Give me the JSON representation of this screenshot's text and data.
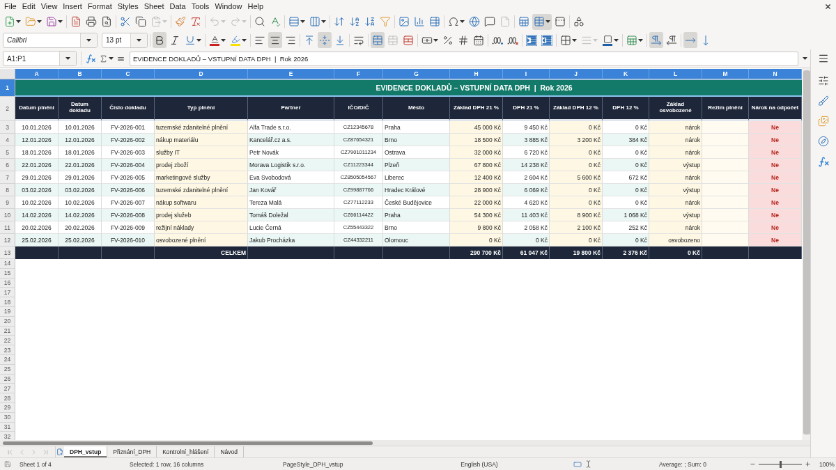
{
  "menu": [
    "File",
    "Edit",
    "View",
    "Insert",
    "Format",
    "Styles",
    "Sheet",
    "Data",
    "Tools",
    "Window",
    "Help"
  ],
  "standard_toolbar": {
    "groups": [
      {
        "buttons": [
          {
            "kind": "new",
            "dropdown": true,
            "pressed": false,
            "disabled": false
          },
          {
            "kind": "open",
            "dropdown": true,
            "pressed": false,
            "disabled": false
          },
          {
            "kind": "save",
            "dropdown": true,
            "pressed": false,
            "disabled": false
          }
        ]
      },
      {
        "buttons": [
          {
            "kind": "export_pdf",
            "dropdown": false,
            "pressed": false,
            "disabled": false
          },
          {
            "kind": "print",
            "dropdown": false,
            "pressed": false,
            "disabled": false
          },
          {
            "kind": "print_preview",
            "dropdown": false,
            "pressed": false,
            "disabled": false
          }
        ]
      },
      {
        "buttons": [
          {
            "kind": "cut",
            "dropdown": false,
            "pressed": false,
            "disabled": false
          },
          {
            "kind": "copy",
            "dropdown": false,
            "pressed": false,
            "disabled": false
          },
          {
            "kind": "paste",
            "dropdown": true,
            "pressed": false,
            "disabled": true
          }
        ]
      },
      {
        "buttons": [
          {
            "kind": "clone_formatting",
            "dropdown": false,
            "pressed": false,
            "disabled": false
          },
          {
            "kind": "clear_formatting",
            "dropdown": false,
            "pressed": false,
            "disabled": false
          }
        ]
      },
      {
        "buttons": [
          {
            "kind": "undo",
            "dropdown": true,
            "pressed": false,
            "disabled": true
          },
          {
            "kind": "redo",
            "dropdown": true,
            "pressed": false,
            "disabled": true
          }
        ]
      },
      {
        "buttons": [
          {
            "kind": "find_replace",
            "dropdown": false,
            "pressed": false,
            "disabled": false
          },
          {
            "kind": "spelling",
            "dropdown": false,
            "pressed": false,
            "disabled": false
          }
        ]
      },
      {
        "buttons": [
          {
            "kind": "row",
            "dropdown": true,
            "pressed": false,
            "disabled": false
          },
          {
            "kind": "column",
            "dropdown": true,
            "pressed": false,
            "disabled": false
          }
        ]
      },
      {
        "buttons": [
          {
            "kind": "sort",
            "dropdown": false,
            "pressed": false,
            "disabled": false
          },
          {
            "kind": "sort_ascending",
            "dropdown": false,
            "pressed": false,
            "disabled": false
          },
          {
            "kind": "sort_descending",
            "dropdown": false,
            "pressed": false,
            "disabled": false
          },
          {
            "kind": "autofilter",
            "dropdown": false,
            "pressed": false,
            "disabled": false
          }
        ]
      },
      {
        "buttons": [
          {
            "kind": "image",
            "dropdown": false,
            "pressed": false,
            "disabled": false
          },
          {
            "kind": "chart",
            "dropdown": false,
            "pressed": false,
            "disabled": false
          },
          {
            "kind": "pivot_table",
            "dropdown": false,
            "pressed": false,
            "disabled": false
          }
        ]
      },
      {
        "buttons": [
          {
            "kind": "special_character",
            "dropdown": true,
            "pressed": false,
            "disabled": false
          },
          {
            "kind": "hyperlink",
            "dropdown": false,
            "pressed": false,
            "disabled": false
          },
          {
            "kind": "comment",
            "dropdown": false,
            "pressed": false,
            "disabled": false
          },
          {
            "kind": "header_footer",
            "dropdown": false,
            "pressed": false,
            "disabled": true
          }
        ]
      },
      {
        "buttons": [
          {
            "kind": "print_area",
            "dropdown": false,
            "pressed": false,
            "disabled": false
          },
          {
            "kind": "freeze",
            "dropdown": true,
            "pressed": true,
            "disabled": false
          },
          {
            "kind": "split_window",
            "dropdown": false,
            "pressed": false,
            "disabled": false
          }
        ]
      },
      {
        "buttons": [
          {
            "kind": "draw_functions",
            "dropdown": false,
            "pressed": false,
            "disabled": false
          }
        ]
      }
    ]
  },
  "formatting_toolbar": {
    "font_name": "Calibri",
    "font_size": "13 pt",
    "groups": [
      {
        "buttons": [
          {
            "kind": "bold",
            "dropdown": false,
            "pressed": true,
            "disabled": false
          },
          {
            "kind": "italic",
            "dropdown": false,
            "pressed": false,
            "disabled": false
          },
          {
            "kind": "underline",
            "dropdown": true,
            "pressed": false,
            "disabled": false
          }
        ]
      },
      {
        "buttons": [
          {
            "kind": "font_color",
            "dropdown": true,
            "pressed": false,
            "disabled": false
          },
          {
            "kind": "highlight",
            "dropdown": true,
            "pressed": false,
            "disabled": false
          }
        ]
      },
      {
        "buttons": [
          {
            "kind": "align_left",
            "dropdown": false,
            "pressed": false,
            "disabled": false
          },
          {
            "kind": "align_center",
            "dropdown": false,
            "pressed": true,
            "disabled": false
          },
          {
            "kind": "align_right",
            "dropdown": false,
            "pressed": false,
            "disabled": false
          }
        ]
      },
      {
        "buttons": [
          {
            "kind": "align_top",
            "dropdown": false,
            "pressed": false,
            "disabled": false
          },
          {
            "kind": "center_vertically",
            "dropdown": false,
            "pressed": true,
            "disabled": false
          },
          {
            "kind": "align_bottom",
            "dropdown": false,
            "pressed": false,
            "disabled": false
          }
        ]
      },
      {
        "buttons": [
          {
            "kind": "wrap_text",
            "dropdown": false,
            "pressed": false,
            "disabled": false
          }
        ]
      },
      {
        "buttons": [
          {
            "kind": "merge_center",
            "dropdown": false,
            "pressed": true,
            "disabled": false
          },
          {
            "kind": "merge_cells",
            "dropdown": false,
            "pressed": false,
            "disabled": true
          },
          {
            "kind": "unmerge",
            "dropdown": false,
            "pressed": false,
            "disabled": false
          }
        ]
      },
      {
        "buttons": [
          {
            "kind": "currency",
            "dropdown": true,
            "pressed": false,
            "disabled": false
          },
          {
            "kind": "percent",
            "dropdown": false,
            "pressed": false,
            "disabled": false
          },
          {
            "kind": "number",
            "dropdown": false,
            "pressed": false,
            "disabled": false
          },
          {
            "kind": "date",
            "dropdown": false,
            "pressed": false,
            "disabled": false
          }
        ]
      },
      {
        "buttons": [
          {
            "kind": "add_decimal",
            "dropdown": false,
            "pressed": false,
            "disabled": false
          },
          {
            "kind": "delete_decimal",
            "dropdown": false,
            "pressed": false,
            "disabled": false
          }
        ]
      },
      {
        "buttons": [
          {
            "kind": "indent_increase",
            "dropdown": false,
            "pressed": false,
            "disabled": false
          },
          {
            "kind": "indent_decrease",
            "dropdown": false,
            "pressed": false,
            "disabled": false
          }
        ]
      },
      {
        "buttons": [
          {
            "kind": "borders",
            "dropdown": true,
            "pressed": false,
            "disabled": false
          },
          {
            "kind": "border_style",
            "dropdown": true,
            "pressed": false,
            "disabled": true
          },
          {
            "kind": "border_color",
            "dropdown": true,
            "pressed": false,
            "disabled": false
          }
        ]
      },
      {
        "buttons": [
          {
            "kind": "conditional",
            "dropdown": true,
            "pressed": false,
            "disabled": false
          }
        ]
      },
      {
        "buttons": [
          {
            "kind": "left_to_right",
            "dropdown": false,
            "pressed": true,
            "disabled": false
          },
          {
            "kind": "right_to_left",
            "dropdown": false,
            "pressed": false,
            "disabled": false
          }
        ]
      },
      {
        "buttons": [
          {
            "kind": "text_horizontal",
            "dropdown": false,
            "pressed": true,
            "disabled": false
          },
          {
            "kind": "text_vertical",
            "dropdown": false,
            "pressed": false,
            "disabled": false
          }
        ]
      }
    ]
  },
  "formula_bar": {
    "cell_reference": "A1:P1",
    "content": "EVIDENCE DOKLADŮ – VSTUPNÍ DATA DPH  |  Rok 2026"
  },
  "sheet": {
    "columns": [
      {
        "label": "A",
        "selected": true
      },
      {
        "label": "B",
        "selected": true
      },
      {
        "label": "C",
        "selected": true
      },
      {
        "label": "D",
        "selected": true
      },
      {
        "label": "E",
        "selected": true
      },
      {
        "label": "F",
        "selected": true
      },
      {
        "label": "G",
        "selected": true
      },
      {
        "label": "H",
        "selected": true
      },
      {
        "label": "I",
        "selected": true
      },
      {
        "label": "J",
        "selected": true
      },
      {
        "label": "K",
        "selected": true
      },
      {
        "label": "L",
        "selected": true
      },
      {
        "label": "M",
        "selected": true
      },
      {
        "label": "N",
        "selected": true
      }
    ],
    "row_numbers": [
      {
        "label": "1",
        "selected": true
      },
      {
        "label": "2",
        "selected": false
      },
      {
        "label": "3",
        "selected": false
      },
      {
        "label": "4",
        "selected": false
      },
      {
        "label": "5",
        "selected": false
      },
      {
        "label": "6",
        "selected": false
      },
      {
        "label": "7",
        "selected": false
      },
      {
        "label": "8",
        "selected": false
      },
      {
        "label": "9",
        "selected": false
      },
      {
        "label": "10",
        "selected": false
      },
      {
        "label": "11",
        "selected": false
      },
      {
        "label": "12",
        "selected": false
      },
      {
        "label": "13",
        "selected": false
      },
      {
        "label": "14",
        "selected": false
      },
      {
        "label": "15",
        "selected": false
      },
      {
        "label": "16",
        "selected": false
      },
      {
        "label": "17",
        "selected": false
      },
      {
        "label": "18",
        "selected": false
      },
      {
        "label": "19",
        "selected": false
      },
      {
        "label": "20",
        "selected": false
      },
      {
        "label": "21",
        "selected": false
      },
      {
        "label": "22",
        "selected": false
      },
      {
        "label": "23",
        "selected": false
      },
      {
        "label": "24",
        "selected": false
      },
      {
        "label": "25",
        "selected": false
      },
      {
        "label": "26",
        "selected": false
      },
      {
        "label": "27",
        "selected": false
      },
      {
        "label": "28",
        "selected": false
      },
      {
        "label": "29",
        "selected": false
      },
      {
        "label": "30",
        "selected": false
      },
      {
        "label": "31",
        "selected": false
      },
      {
        "label": "32",
        "selected": false
      }
    ],
    "title": "EVIDENCE DOKLADŮ – VSTUPNÍ DATA DPH  |  Rok 2026",
    "headers": [
      "Datum plnění",
      "Datum dokladu",
      "Číslo dokladu",
      "Typ plnění",
      "Partner",
      "IČO/DIČ",
      "Město",
      "Základ DPH 21 %",
      "DPH 21 %",
      "Základ DPH 12 %",
      "DPH 12 %",
      "Základ osvobozené",
      "Režim plnění",
      "Nárok na odpočet"
    ],
    "rows": [
      {
        "date_of_supply": "10.01.2026",
        "document_date": "10.01.2026",
        "document_number": "FV-2026-001",
        "supply_type": "tuzemské zdanitelné plnění",
        "partner": "Alfa Trade s.r.o.",
        "ico_dic": "CZ12345678",
        "city": "Praha",
        "base_21": "45 000 Kč",
        "vat_21": "9 450 Kč",
        "base_12": "0 Kč",
        "vat_12": "0 Kč",
        "exempt_base": "nárok",
        "deduction_claim": "Ne"
      },
      {
        "date_of_supply": "12.01.2026",
        "document_date": "12.01.2026",
        "document_number": "FV-2026-002",
        "supply_type": "nákup materiálu",
        "partner": "Kancelář.cz a.s.",
        "ico_dic": "CZ87654321",
        "city": "Brno",
        "base_21": "18 500 Kč",
        "vat_21": "3 885 Kč",
        "base_12": "3 200 Kč",
        "vat_12": "384 Kč",
        "exempt_base": "nárok",
        "deduction_claim": "Ne"
      },
      {
        "date_of_supply": "18.01.2026",
        "document_date": "18.01.2026",
        "document_number": "FV-2026-003",
        "supply_type": "služby IT",
        "partner": "Petr Novák",
        "ico_dic": "CZ7901011234",
        "city": "Ostrava",
        "base_21": "32 000 Kč",
        "vat_21": "6 720 Kč",
        "base_12": "0 Kč",
        "vat_12": "0 Kč",
        "exempt_base": "nárok",
        "deduction_claim": "Ne"
      },
      {
        "date_of_supply": "22.01.2026",
        "document_date": "22.01.2026",
        "document_number": "FV-2026-004",
        "supply_type": "prodej zboží",
        "partner": "Morava Logistik s.r.o.",
        "ico_dic": "CZ11223344",
        "city": "Plzeň",
        "base_21": "67 800 Kč",
        "vat_21": "14 238 Kč",
        "base_12": "0 Kč",
        "vat_12": "0 Kč",
        "exempt_base": "výstup",
        "deduction_claim": "Ne"
      },
      {
        "date_of_supply": "29.01.2026",
        "document_date": "29.01.2026",
        "document_number": "FV-2026-005",
        "supply_type": "marketingové služby",
        "partner": "Eva Svobodová",
        "ico_dic": "CZ8505054567",
        "city": "Liberec",
        "base_21": "12 400 Kč",
        "vat_21": "2 604 Kč",
        "base_12": "5 600 Kč",
        "vat_12": "672 Kč",
        "exempt_base": "nárok",
        "deduction_claim": "Ne"
      },
      {
        "date_of_supply": "03.02.2026",
        "document_date": "03.02.2026",
        "document_number": "FV-2026-006",
        "supply_type": "tuzemské zdanitelné plnění",
        "partner": "Jan Kovář",
        "ico_dic": "CZ99887766",
        "city": "Hradec Králové",
        "base_21": "28 900 Kč",
        "vat_21": "6 069 Kč",
        "base_12": "0 Kč",
        "vat_12": "0 Kč",
        "exempt_base": "výstup",
        "deduction_claim": "Ne"
      },
      {
        "date_of_supply": "10.02.2026",
        "document_date": "10.02.2026",
        "document_number": "FV-2026-007",
        "supply_type": "nákup softwaru",
        "partner": "Tereza Malá",
        "ico_dic": "CZ77112233",
        "city": "České Budějovice",
        "base_21": "22 000 Kč",
        "vat_21": "4 620 Kč",
        "base_12": "0 Kč",
        "vat_12": "0 Kč",
        "exempt_base": "nárok",
        "deduction_claim": "Ne"
      },
      {
        "date_of_supply": "14.02.2026",
        "document_date": "14.02.2026",
        "document_number": "FV-2026-008",
        "supply_type": "prodej služeb",
        "partner": "Tomáš Doležal",
        "ico_dic": "CZ66114422",
        "city": "Praha",
        "base_21": "54 300 Kč",
        "vat_21": "11 403 Kč",
        "base_12": "8 900 Kč",
        "vat_12": "1 068 Kč",
        "exempt_base": "výstup",
        "deduction_claim": "Ne"
      },
      {
        "date_of_supply": "20.02.2026",
        "document_date": "20.02.2026",
        "document_number": "FV-2026-009",
        "supply_type": "režijní náklady",
        "partner": "Lucie Černá",
        "ico_dic": "CZ55443322",
        "city": "Brno",
        "base_21": "9 800 Kč",
        "vat_21": "2 058 Kč",
        "base_12": "2 100 Kč",
        "vat_12": "252 Kč",
        "exempt_base": "nárok",
        "deduction_claim": "Ne"
      },
      {
        "date_of_supply": "25.02.2026",
        "document_date": "25.02.2026",
        "document_number": "FV-2026-010",
        "supply_type": "osvobozené plnění",
        "partner": "Jakub Procházka",
        "ico_dic": "CZ44332211",
        "city": "Olomouc",
        "base_21": "0 Kč",
        "vat_21": "0 Kč",
        "base_12": "0 Kč",
        "vat_12": "0 Kč",
        "exempt_base": "osvobozeno",
        "deduction_claim": "Ne"
      }
    ],
    "total": {
      "label": "CELKEM",
      "base_21": "290 700 Kč",
      "vat_21": "61 047 Kč",
      "base_12": "19 800 Kč",
      "vat_12": "2 376 Kč",
      "exempt_base": "0 Kč"
    }
  },
  "sheet_tabs": [
    {
      "label": "DPH_vstup",
      "selected": true
    },
    {
      "label": "Přiznání_DPH",
      "selected": false
    },
    {
      "label": "Kontrolní_hlášení",
      "selected": false
    },
    {
      "label": "Návod",
      "selected": false
    }
  ],
  "status_bar": {
    "sheet": "Sheet 1 of 4",
    "selection": "Selected: 1 row, 16 columns",
    "page_style": "PageStyle_DPH_vstup",
    "language": "English (USA)",
    "summary": "Average: ; Sum: 0",
    "zoom": {
      "level": 0.5,
      "label": "100%"
    }
  }
}
